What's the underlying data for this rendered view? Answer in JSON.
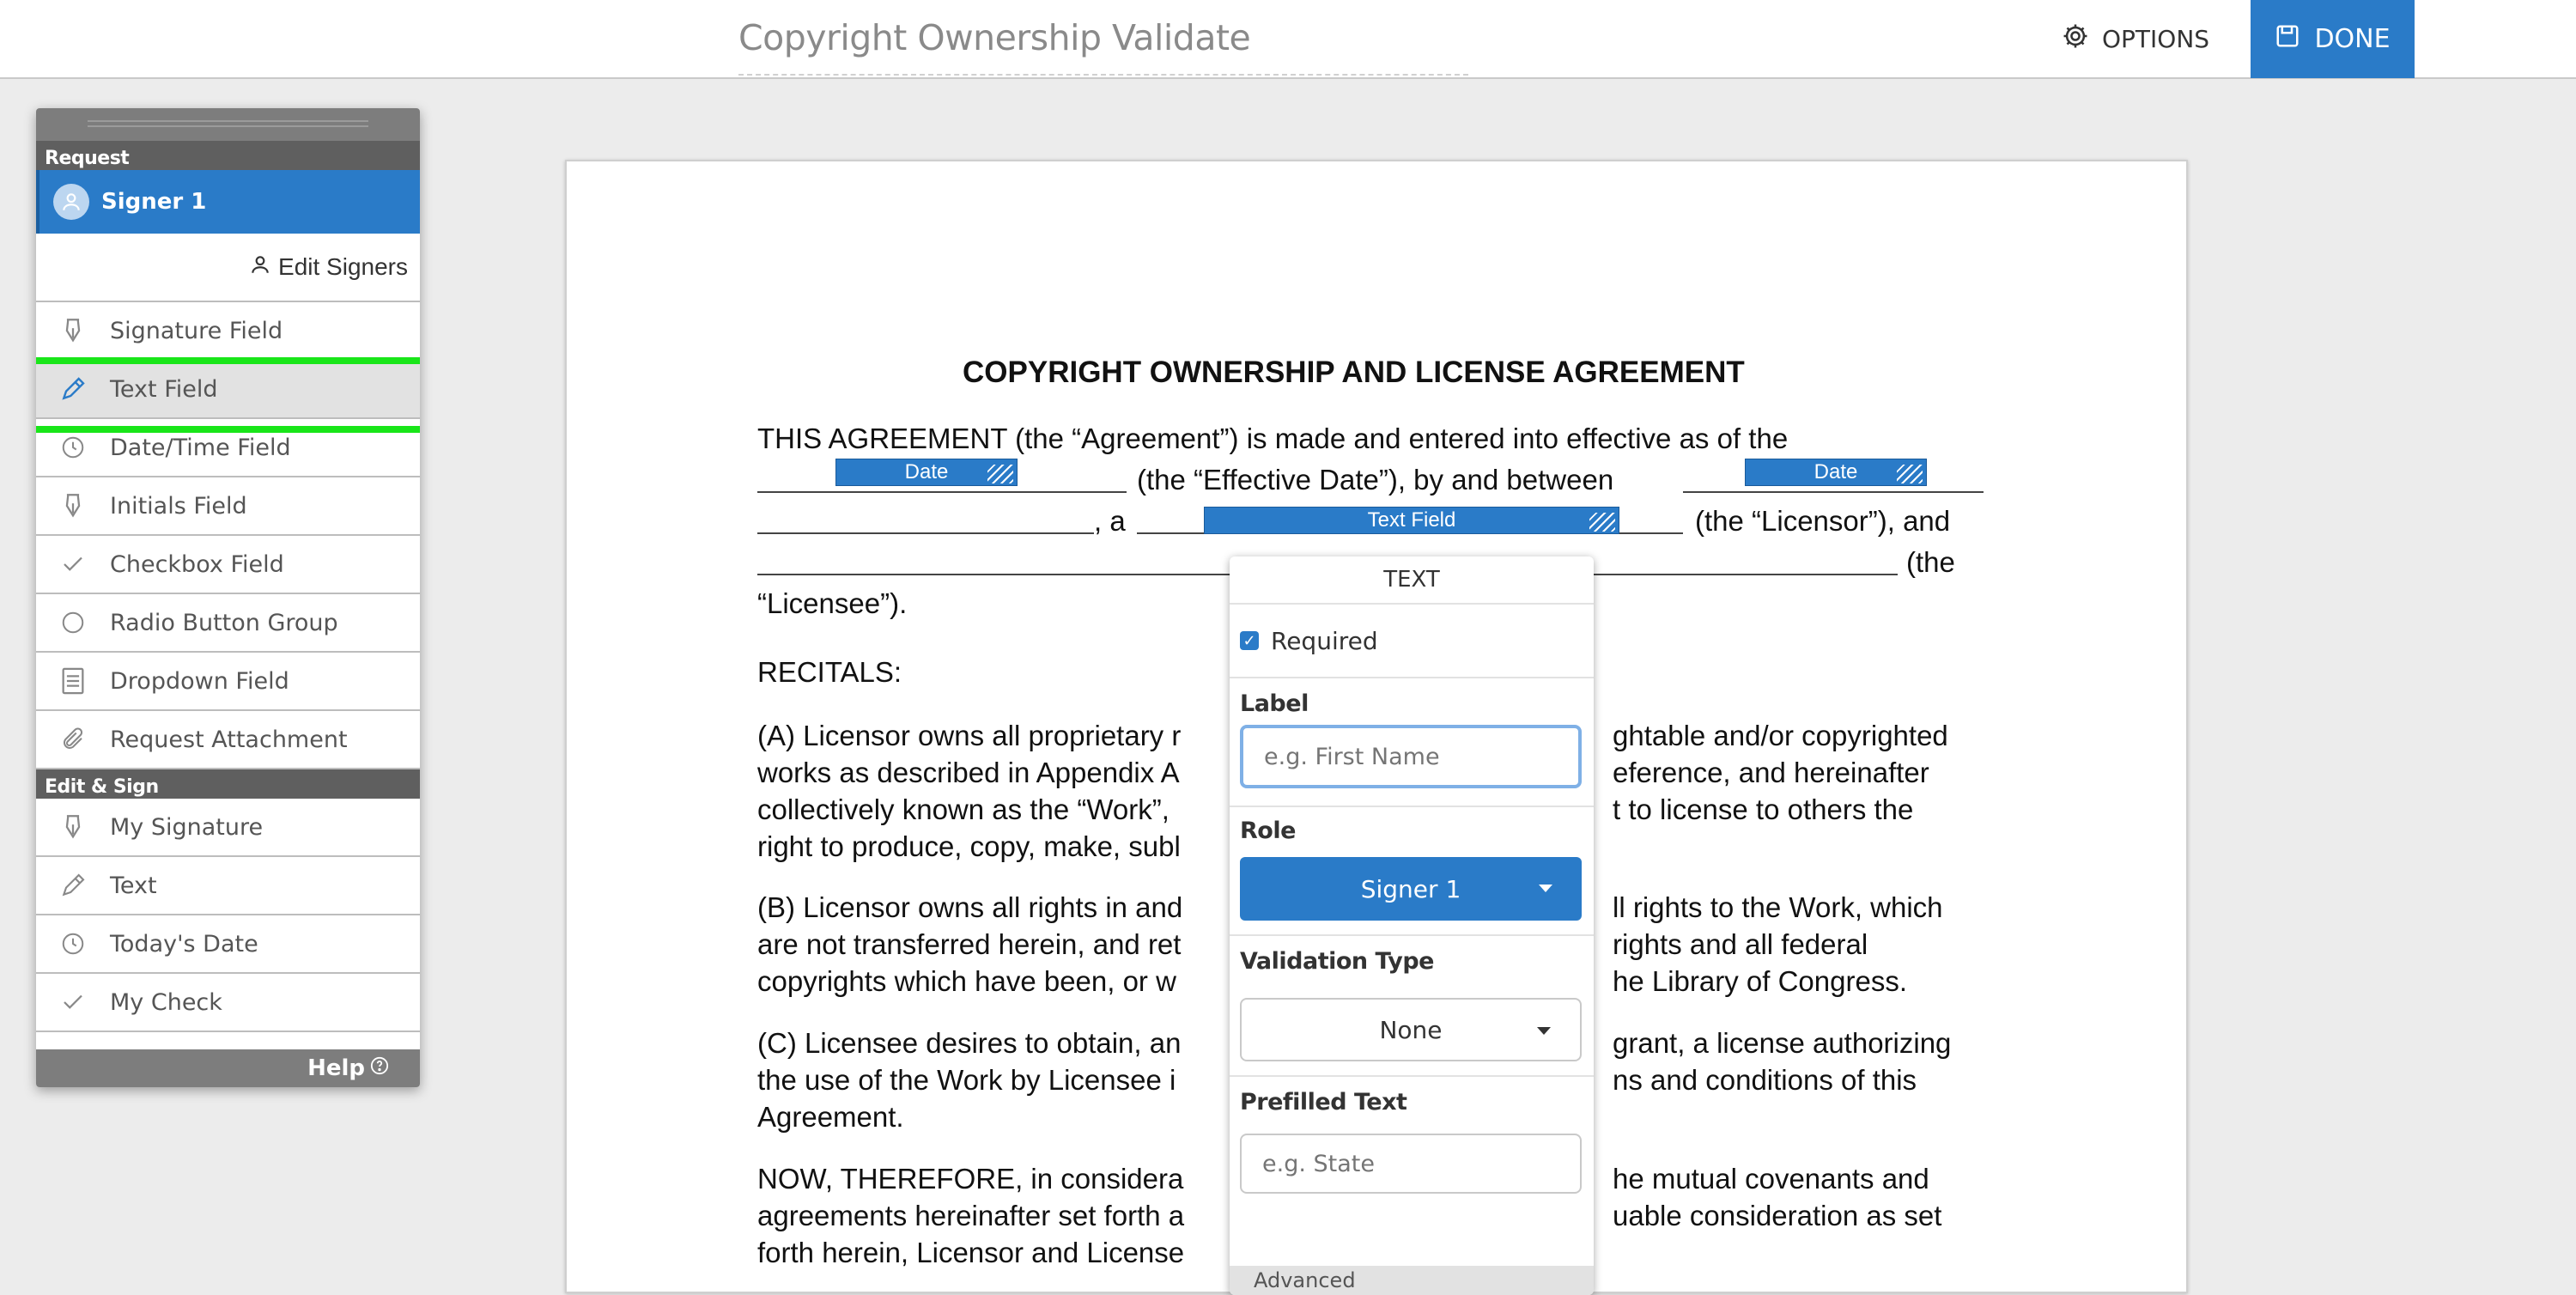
{
  "header": {
    "doc_title": "Copyright Ownership Validate",
    "options_label": "OPTIONS",
    "done_label": "DONE"
  },
  "sidebar": {
    "request_header": "Request",
    "signer": "Signer 1",
    "edit_signers": "Edit Signers",
    "request_tools": [
      {
        "label": "Signature Field",
        "icon": "pen-nib-icon"
      },
      {
        "label": "Text Field",
        "icon": "pencil-icon",
        "selected": true
      },
      {
        "label": "Date/Time Field",
        "icon": "clock-icon"
      },
      {
        "label": "Initials Field",
        "icon": "pen-nib-icon"
      },
      {
        "label": "Checkbox Field",
        "icon": "check-icon"
      },
      {
        "label": "Radio Button Group",
        "icon": "circle-icon"
      },
      {
        "label": "Dropdown Field",
        "icon": "list-icon"
      },
      {
        "label": "Request Attachment",
        "icon": "paperclip-icon"
      }
    ],
    "edit_sign_header": "Edit & Sign",
    "edit_tools": [
      {
        "label": "My Signature",
        "icon": "pen-nib-icon"
      },
      {
        "label": "Text",
        "icon": "pencil-icon"
      },
      {
        "label": "Today's Date",
        "icon": "clock-icon"
      },
      {
        "label": "My Check",
        "icon": "check-icon"
      }
    ],
    "help_label": "Help"
  },
  "document": {
    "heading": "COPYRIGHT OWNERSHIP AND LICENSE AGREEMENT",
    "line1": "THIS AGREEMENT (the “Agreement”) is made and entered into effective as of the",
    "line2_mid": "(the “Effective Date”), by and between",
    "line3_a": ", a",
    "line3_end": "(the “Licensor”), and",
    "line4_end": "(the",
    "line5": "“Licensee”).",
    "recitals": "RECITALS:",
    "para_a": [
      "(A) Licensor owns all proprietary r",
      "works as described in Appendix A",
      "collectively known as the “Work”,",
      "right to produce, copy, make, subl"
    ],
    "para_a_right": [
      "ghtable and/or copyrighted",
      "eference, and hereinafter",
      "t to license to others the"
    ],
    "para_b": [
      "(B) Licensor owns all rights in and",
      "are not transferred herein, and ret",
      "copyrights which have been, or w"
    ],
    "para_b_right": [
      "ll rights to the Work, which",
      "rights and all federal",
      "he Library of Congress."
    ],
    "para_c": [
      "(C) Licensee desires to obtain, an",
      "the use of the Work by Licensee i",
      "Agreement."
    ],
    "para_c_right": [
      "grant, a license authorizing",
      "ns and conditions of this"
    ],
    "para_now": [
      "NOW, THEREFORE, in considera",
      "agreements hereinafter set forth a",
      "forth herein, Licensor and License"
    ],
    "para_now_right": [
      "he mutual covenants and",
      "uable consideration as set"
    ],
    "fields": {
      "date1": "Date",
      "date2": "Date",
      "text1": "Text Field"
    }
  },
  "popover": {
    "title": "TEXT",
    "required_label": "Required",
    "required_checked": true,
    "label_heading": "Label",
    "label_placeholder": "e.g. First Name",
    "role_heading": "Role",
    "role_value": "Signer 1",
    "validation_heading": "Validation Type",
    "validation_value": "None",
    "prefilled_heading": "Prefilled Text",
    "prefilled_placeholder": "e.g. State",
    "advanced_label": "Advanced"
  },
  "colors": {
    "accent": "#2a7bc8",
    "highlight": "#19e619",
    "panel_header": "#5f5f5f"
  }
}
